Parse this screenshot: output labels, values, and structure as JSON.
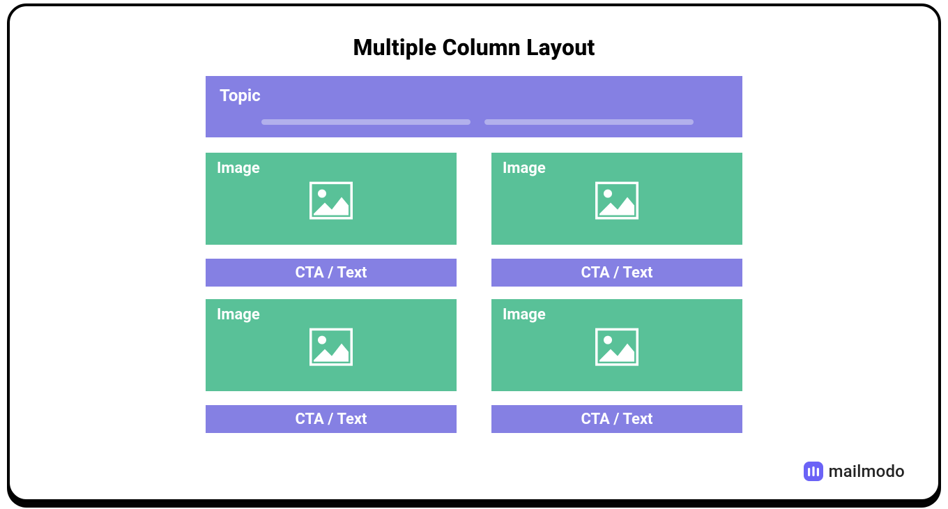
{
  "title": "Multiple Column Layout",
  "topic": {
    "label": "Topic"
  },
  "columns": [
    {
      "image_label": "Image",
      "cta_label": "CTA / Text"
    },
    {
      "image_label": "Image",
      "cta_label": "CTA / Text"
    },
    {
      "image_label": "Image",
      "cta_label": "CTA / Text"
    },
    {
      "image_label": "Image",
      "cta_label": "CTA / Text"
    }
  ],
  "brand": {
    "name": "mailmodo"
  },
  "colors": {
    "primary_purple": "#8580e3",
    "primary_green": "#59c198",
    "line_purple": "#b2b0ec",
    "brand_purple": "#6b63f6"
  }
}
